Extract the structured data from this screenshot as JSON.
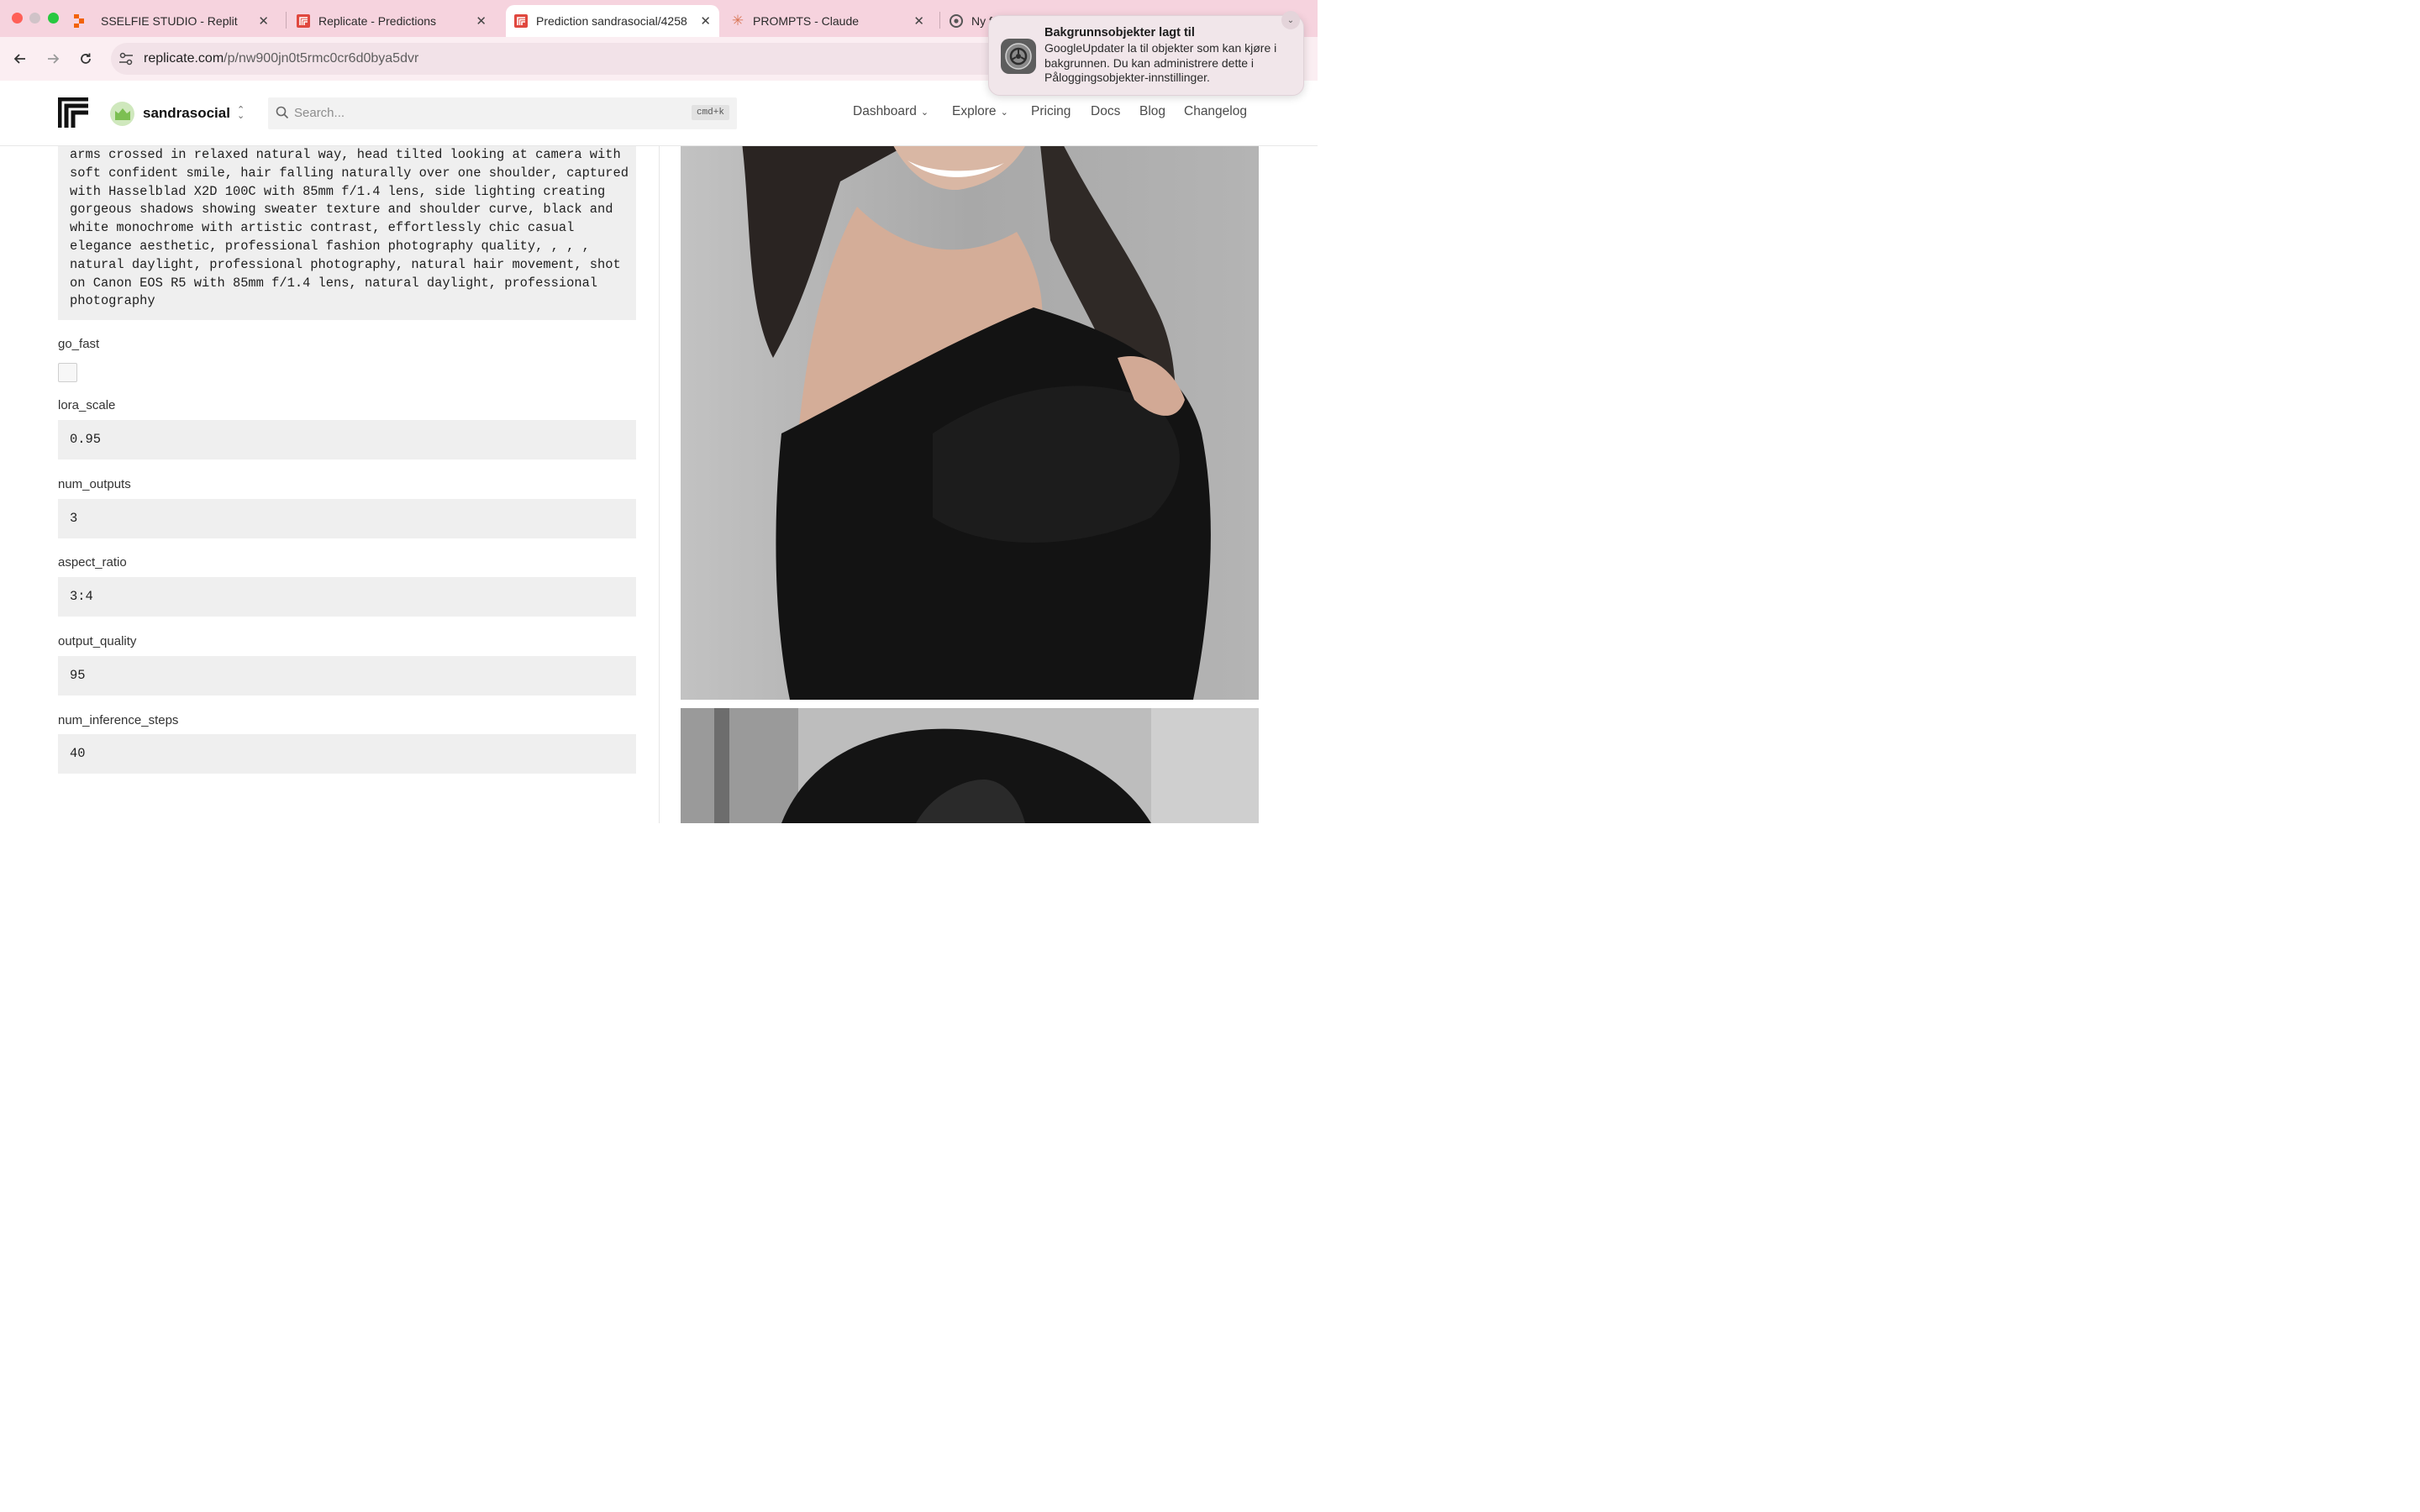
{
  "tabs": [
    {
      "title": "SSELFIE STUDIO - Replit",
      "icon": "replit-icon",
      "active": false
    },
    {
      "title": "Replicate - Predictions",
      "icon": "replicate-icon",
      "active": false
    },
    {
      "title": "Prediction sandrasocial/4258",
      "icon": "replicate-icon",
      "active": true
    },
    {
      "title": "PROMPTS - Claude",
      "icon": "claude-icon",
      "active": false
    },
    {
      "title": "Ny f",
      "icon": "chrome-icon",
      "active": false
    }
  ],
  "address": {
    "host": "replicate.com",
    "path": "/p/nw900jn0t5rmc0cr6d0bya5dvr"
  },
  "header": {
    "account": "sandrasocial",
    "search_placeholder": "Search...",
    "search_shortcut": "cmd+k",
    "nav": {
      "dashboard": "Dashboard",
      "explore": "Explore",
      "pricing": "Pricing",
      "docs": "Docs",
      "blog": "Blog",
      "changelog": "Changelog"
    }
  },
  "form": {
    "prompt_text": "arms crossed in relaxed natural way, head tilted looking at camera with\nsoft confident smile, hair falling naturally over one shoulder, captured\nwith Hasselblad X2D 100C with 85mm f/1.4 lens, side lighting creating\ngorgeous shadows showing sweater texture and shoulder curve, black and\nwhite monochrome with artistic contrast, effortlessly chic casual\nelegance aesthetic, professional fashion photography quality, , , ,\nnatural daylight, professional photography, natural hair movement, shot\non Canon EOS R5 with 85mm f/1.4 lens, natural daylight, professional\nphotography",
    "go_fast_label": "go_fast",
    "go_fast_checked": false,
    "fields": [
      {
        "label": "lora_scale",
        "value": "0.95"
      },
      {
        "label": "num_outputs",
        "value": "3"
      },
      {
        "label": "aspect_ratio",
        "value": "3:4"
      },
      {
        "label": "output_quality",
        "value": "95"
      },
      {
        "label": "num_inference_steps",
        "value": "40"
      }
    ]
  },
  "notification": {
    "title": "Bakgrunnsobjekter lagt til",
    "body": "GoogleUpdater la til objekter som kan kjøre i bakgrunnen. Du kan administrere dette i Påloggingsobjekter-innstillinger."
  }
}
